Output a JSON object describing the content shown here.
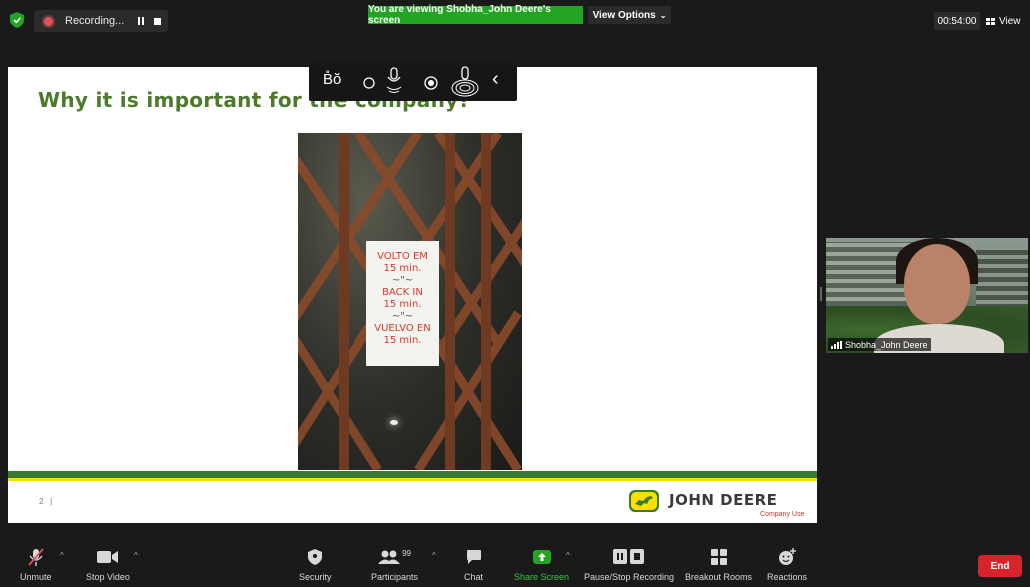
{
  "top_bar": {
    "recording_label": "Recording...",
    "viewing_banner": "You are viewing Shobha_John Deere's screen",
    "view_options_label": "View Options",
    "timer": "00:54:00",
    "view_label": "View"
  },
  "slide": {
    "title": "Why it is important for the company?",
    "page_number": "2",
    "page_separator": "|",
    "brand_name": "JOHN DEERE",
    "classification": "Company Use",
    "note_lines": [
      "VOLTO EM",
      "15 min.",
      "~\"~",
      "BACK IN",
      "15 min.",
      "~\"~",
      "VUELVO EN",
      "15 min."
    ],
    "colors": {
      "title_green": "#4b7a2a",
      "brand_green": "#367c2b",
      "brand_yellow": "#ffde00"
    }
  },
  "annotation_toolbar": {
    "tools": [
      "text-tool-icon",
      "circle-icon",
      "microphone-icon",
      "record-dot-icon",
      "mic-spotlight-icon",
      "collapse-chevron-icon"
    ]
  },
  "participant": {
    "name": "Shobha_John Deere"
  },
  "bottom_bar": {
    "unmute": "Unmute",
    "stop_video": "Stop Video",
    "security": "Security",
    "participants": "Participants",
    "participant_count": "99",
    "chat": "Chat",
    "share_screen": "Share Screen",
    "pause_stop_recording": "Pause/Stop Recording",
    "breakout_rooms": "Breakout Rooms",
    "reactions": "Reactions",
    "end": "End",
    "colors": {
      "end_red": "#d9232a",
      "share_green": "#23a523"
    }
  }
}
